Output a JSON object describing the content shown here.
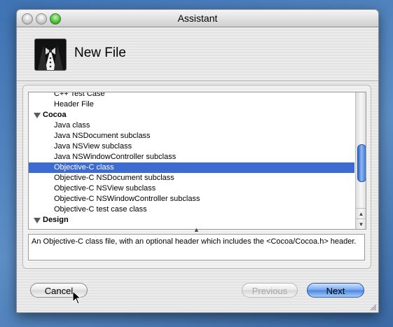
{
  "window": {
    "title": "Assistant"
  },
  "header": {
    "title": "New File",
    "icon": "butler-icon"
  },
  "template_list": {
    "rows": [
      {
        "type": "item",
        "label": "C++ Test Case"
      },
      {
        "type": "item",
        "label": "Header File"
      },
      {
        "type": "group",
        "label": "Cocoa"
      },
      {
        "type": "item",
        "label": "Java class"
      },
      {
        "type": "item",
        "label": "Java NSDocument subclass"
      },
      {
        "type": "item",
        "label": "Java NSView subclass"
      },
      {
        "type": "item",
        "label": "Java NSWindowController subclass"
      },
      {
        "type": "item",
        "label": "Objective-C class",
        "selected": true
      },
      {
        "type": "item",
        "label": "Objective-C NSDocument subclass"
      },
      {
        "type": "item",
        "label": "Objective-C NSView subclass"
      },
      {
        "type": "item",
        "label": "Objective-C NSWindowController subclass"
      },
      {
        "type": "item",
        "label": "Objective-C test case class"
      },
      {
        "type": "group",
        "label": "Design"
      }
    ]
  },
  "description": "An Objective-C class file, with an optional header which includes the <Cocoa/Cocoa.h> header.",
  "buttons": {
    "cancel": "Cancel",
    "previous": "Previous",
    "next": "Next"
  },
  "colors": {
    "selection": "#3d6bd1",
    "accent": "#4b85e0",
    "desktop": "#4f7fb6"
  }
}
